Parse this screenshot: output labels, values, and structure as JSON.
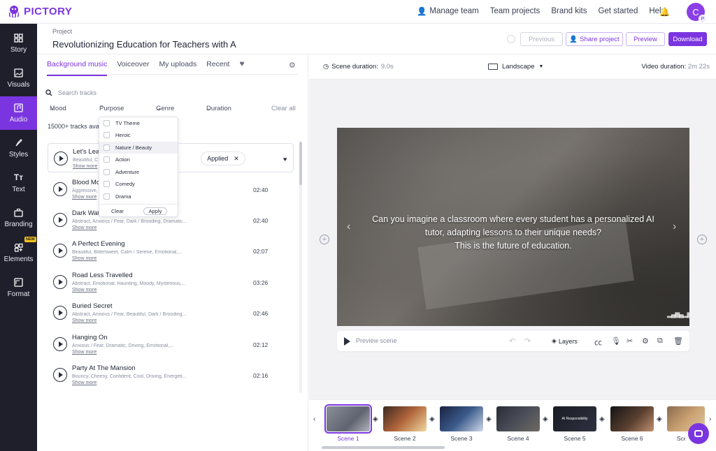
{
  "app": {
    "brand": "PICTORY"
  },
  "topnav": {
    "manage_team": "Manage team",
    "team_projects": "Team projects",
    "brand_kits": "Brand kits",
    "get_started": "Get started",
    "help": "Help",
    "avatar_initial": "C",
    "avatar_sub": "P"
  },
  "sidebar": {
    "items": [
      {
        "label": "Story",
        "icon": "story-grid-icon"
      },
      {
        "label": "Visuals",
        "icon": "image-icon"
      },
      {
        "label": "Audio",
        "icon": "music-note-icon"
      },
      {
        "label": "Styles",
        "icon": "brush-icon"
      },
      {
        "label": "Text",
        "icon": "text-icon"
      },
      {
        "label": "Branding",
        "icon": "briefcase-icon"
      },
      {
        "label": "Elements",
        "icon": "shapes-icon"
      },
      {
        "label": "Format",
        "icon": "crop-icon"
      }
    ],
    "new_badge": "NEW",
    "active_color": "#7b35e0"
  },
  "header": {
    "project_label": "Project",
    "title": "Revolutionizing Education for Teachers with A",
    "previous": "Previous",
    "share": "Share project",
    "preview": "Preview",
    "download": "Download"
  },
  "audio": {
    "tabs": [
      "Background music",
      "Voiceover",
      "My uploads",
      "Recent"
    ],
    "search_placeholder": "Search tracks",
    "filters": {
      "mood": "Mood",
      "purpose": "Purpose",
      "genre": "Genre",
      "duration": "Duration",
      "clear_all": "Clear all"
    },
    "count": "15000+ tracks available",
    "applied_label": "Applied",
    "show_more": "Show more",
    "tracks": [
      {
        "name": "Let's Lea",
        "desc": "Beautiful, C",
        "duration": ""
      },
      {
        "name": "Blood Mo",
        "desc": "Aggressive,                                  Dark /...",
        "duration": "02:40"
      },
      {
        "name": "Dark Wat",
        "desc": "Abstract, Anxious / Fear, Dark / Brooding, Dramatic...",
        "duration": "02:40"
      },
      {
        "name": "A Perfect Evening",
        "desc": "Beautiful, Bittersweet, Calm / Serene, Emotional,...",
        "duration": "02:07"
      },
      {
        "name": "Road Less Travelled",
        "desc": "Abstract, Emotional, Haunting, Moody, Mysterious,...",
        "duration": "03:26"
      },
      {
        "name": "Buried Secret",
        "desc": "Abstract, Anxious / Fear, Beautiful, Dark / Brooding...",
        "duration": "02:46"
      },
      {
        "name": "Hanging On",
        "desc": "Anxious / Fear, Dramatic, Driving, Emotional,...",
        "duration": "02:12"
      },
      {
        "name": "Party At The Mansion",
        "desc": "Bouncy, Cheesy, Confident, Cool, Driving, Energeti...",
        "duration": "02:16"
      }
    ],
    "purpose_options": [
      "TV Theme",
      "Heroic",
      "Nature / Beauty",
      "Action",
      "Adventure",
      "Comedy",
      "Drama"
    ],
    "dropdown_clear": "Clear",
    "dropdown_apply": "Apply"
  },
  "editor": {
    "scene_duration_label": "Scene duration:",
    "scene_duration": "9.0s",
    "orientation": "Landscape",
    "video_duration_label": "Video duration:",
    "video_duration": "2m 22s",
    "caption": [
      "Can you imagine a classroom where every student has a personalized AI",
      "tutor, adapting lessons to their unique needs?",
      "This is the future of education."
    ],
    "preview_scene": "Preview scene",
    "layers": "Layers"
  },
  "scenes": [
    "Scene 1",
    "Scene 2",
    "Scene 3",
    "Scene 4",
    "Scene 5",
    "Scene 6",
    "Sce"
  ],
  "scene_thumb_text": "AI Responsibility"
}
